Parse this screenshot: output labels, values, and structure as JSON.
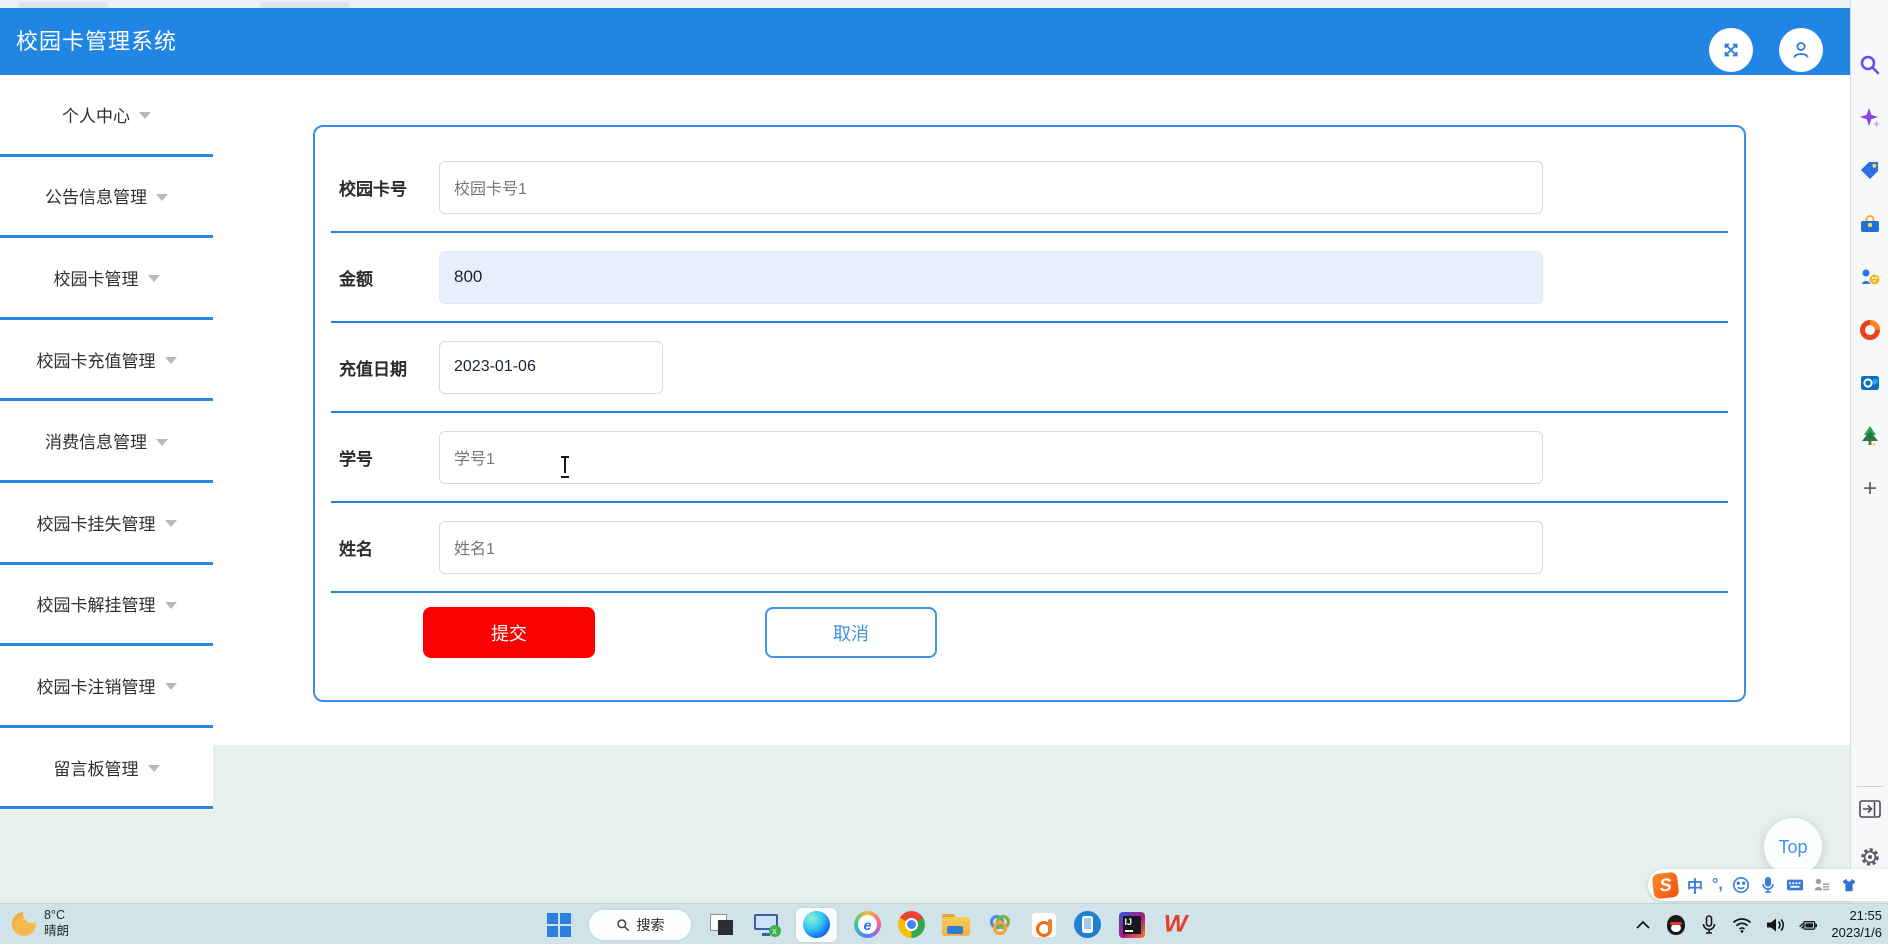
{
  "header": {
    "title": "校园卡管理系统",
    "buttons": [
      {
        "name": "fullscreen-toggle"
      },
      {
        "name": "user-profile"
      }
    ]
  },
  "sidebar": {
    "items": [
      {
        "label": "个人中心"
      },
      {
        "label": "公告信息管理"
      },
      {
        "label": "校园卡管理"
      },
      {
        "label": "校园卡充值管理"
      },
      {
        "label": "消费信息管理"
      },
      {
        "label": "校园卡挂失管理"
      },
      {
        "label": "校园卡解挂管理"
      },
      {
        "label": "校园卡注销管理"
      },
      {
        "label": "留言板管理"
      }
    ]
  },
  "form": {
    "fields": [
      {
        "label": "校园卡号",
        "value": "校园卡号1"
      },
      {
        "label": "金额",
        "value": "800"
      },
      {
        "label": "充值日期",
        "value": "2023-01-06"
      },
      {
        "label": "学号",
        "value": "学号1"
      },
      {
        "label": "姓名",
        "value": "姓名1"
      }
    ],
    "submit_label": "提交",
    "cancel_label": "取消"
  },
  "floating": {
    "top_button_label": "Top"
  },
  "edge_sidebar": {
    "icons": [
      "search",
      "copilot",
      "shopping",
      "toolbox",
      "games",
      "office",
      "outlook",
      "tree",
      "add-to-sidebar",
      "collapse-sidebar",
      "sidebar-settings"
    ]
  },
  "ime_bar": {
    "logo": "S",
    "mode": "中",
    "punct": "°,",
    "icons": [
      "emoji",
      "voice-input",
      "soft-keyboard",
      "phrase",
      "skin"
    ]
  },
  "taskbar": {
    "weather": {
      "temp": "8°C",
      "condition": "晴朗"
    },
    "search_label": "搜索",
    "icons": [
      "windows-start",
      "search",
      "task-view",
      "xshell",
      "edge-browser",
      "ie-360-browser",
      "chrome",
      "file-explorer",
      "navicat",
      "media-app",
      "phone-link",
      "intellij-idea",
      "wps-office"
    ],
    "tray": {
      "time": "21:55",
      "date": "2023/1/6",
      "icons": [
        "tray-expand",
        "qq",
        "microphone",
        "wifi",
        "volume",
        "battery"
      ]
    }
  },
  "colors": {
    "header_blue": "#2186e3",
    "menu_divider_blue": "#2b85e4",
    "row_separator_blue": "#2482d9",
    "panel_border_blue": "#3a8ee6",
    "submit_red": "#f70102",
    "cancel_blue": "#3f94e8",
    "amount_field_bg": "#e8effb",
    "content_green": "#e7f0ea",
    "taskbar_bg": "#cfe3e9"
  }
}
